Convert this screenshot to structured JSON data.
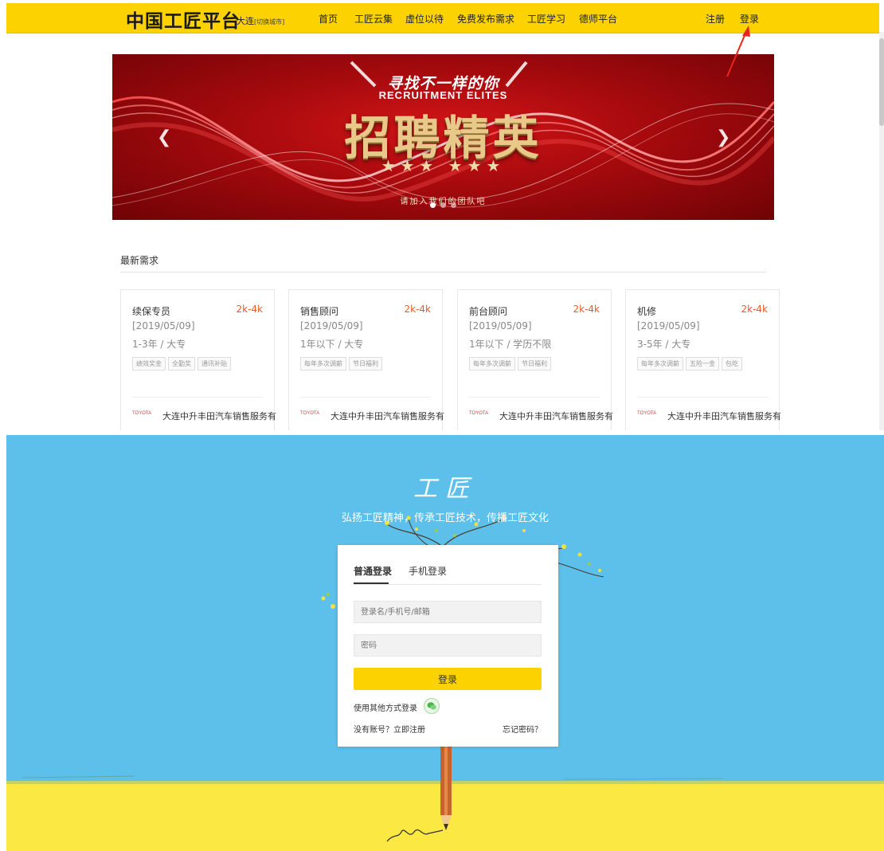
{
  "header": {
    "brand": "中国工匠平台",
    "city": "大连",
    "city_switch": "[切换城市]",
    "nav": [
      "首页",
      "工匠云集",
      "虚位以待",
      "免费发布需求",
      "工匠学习",
      "德师平台"
    ],
    "register": "注册",
    "login": "登录"
  },
  "banner": {
    "subtitle": "寻找不一样的你",
    "subtitle_en": "RECRUITMENT ELITES",
    "title": "招聘精英",
    "stars": "★★★  ★★★",
    "tagline": "请加入我们的团队吧",
    "prev_icon": "chevron-left-icon",
    "next_icon": "chevron-right-icon"
  },
  "section": {
    "title": "最新需求"
  },
  "jobs": [
    {
      "title": "续保专员",
      "salary": "2k-4k",
      "date": "[2019/05/09]",
      "requirement": "1-3年 / 大专",
      "tags": [
        "绩效奖金",
        "全勤奖",
        "通讯补贴"
      ],
      "logo": "TOYOTA",
      "company": "大连中升丰田汽车销售服务有"
    },
    {
      "title": "销售顾问",
      "salary": "2k-4k",
      "date": "[2019/05/09]",
      "requirement": "1年以下 / 大专",
      "tags": [
        "每年多次调薪",
        "节日福利"
      ],
      "logo": "TOYOTA",
      "company": "大连中升丰田汽车销售服务有"
    },
    {
      "title": "前台顾问",
      "salary": "2k-4k",
      "date": "[2019/05/09]",
      "requirement": "1年以下 / 学历不限",
      "tags": [
        "每年多次调薪",
        "节日福利"
      ],
      "logo": "TOYOTA",
      "company": "大连中升丰田汽车销售服务有"
    },
    {
      "title": "机修",
      "salary": "2k-4k",
      "date": "[2019/05/09]",
      "requirement": "3-5年 / 大专",
      "tags": [
        "每年多次调薪",
        "五险一金",
        "包吃"
      ],
      "logo": "TOYOTA",
      "company": "大连中升丰田汽车销售服务有"
    }
  ],
  "login_page": {
    "logo": "工匠",
    "slogan": "弘扬工匠精神，传承工匠技术，传播工匠文化",
    "tabs": [
      "普通登录",
      "手机登录"
    ],
    "username_placeholder": "登录名/手机号/邮箱",
    "password_placeholder": "密码",
    "submit": "登录",
    "other_login": "使用其他方式登录",
    "other_login_icon": "wechat-icon",
    "register": "没有账号？立即注册",
    "forgot": "忘记密码？"
  },
  "colors": {
    "accent_yellow": "#fcd200",
    "salary_orange": "#ee5a24",
    "sky_blue": "#5cc0ea",
    "banner_red": "#c8101a",
    "annotation_red": "#e8251e"
  }
}
